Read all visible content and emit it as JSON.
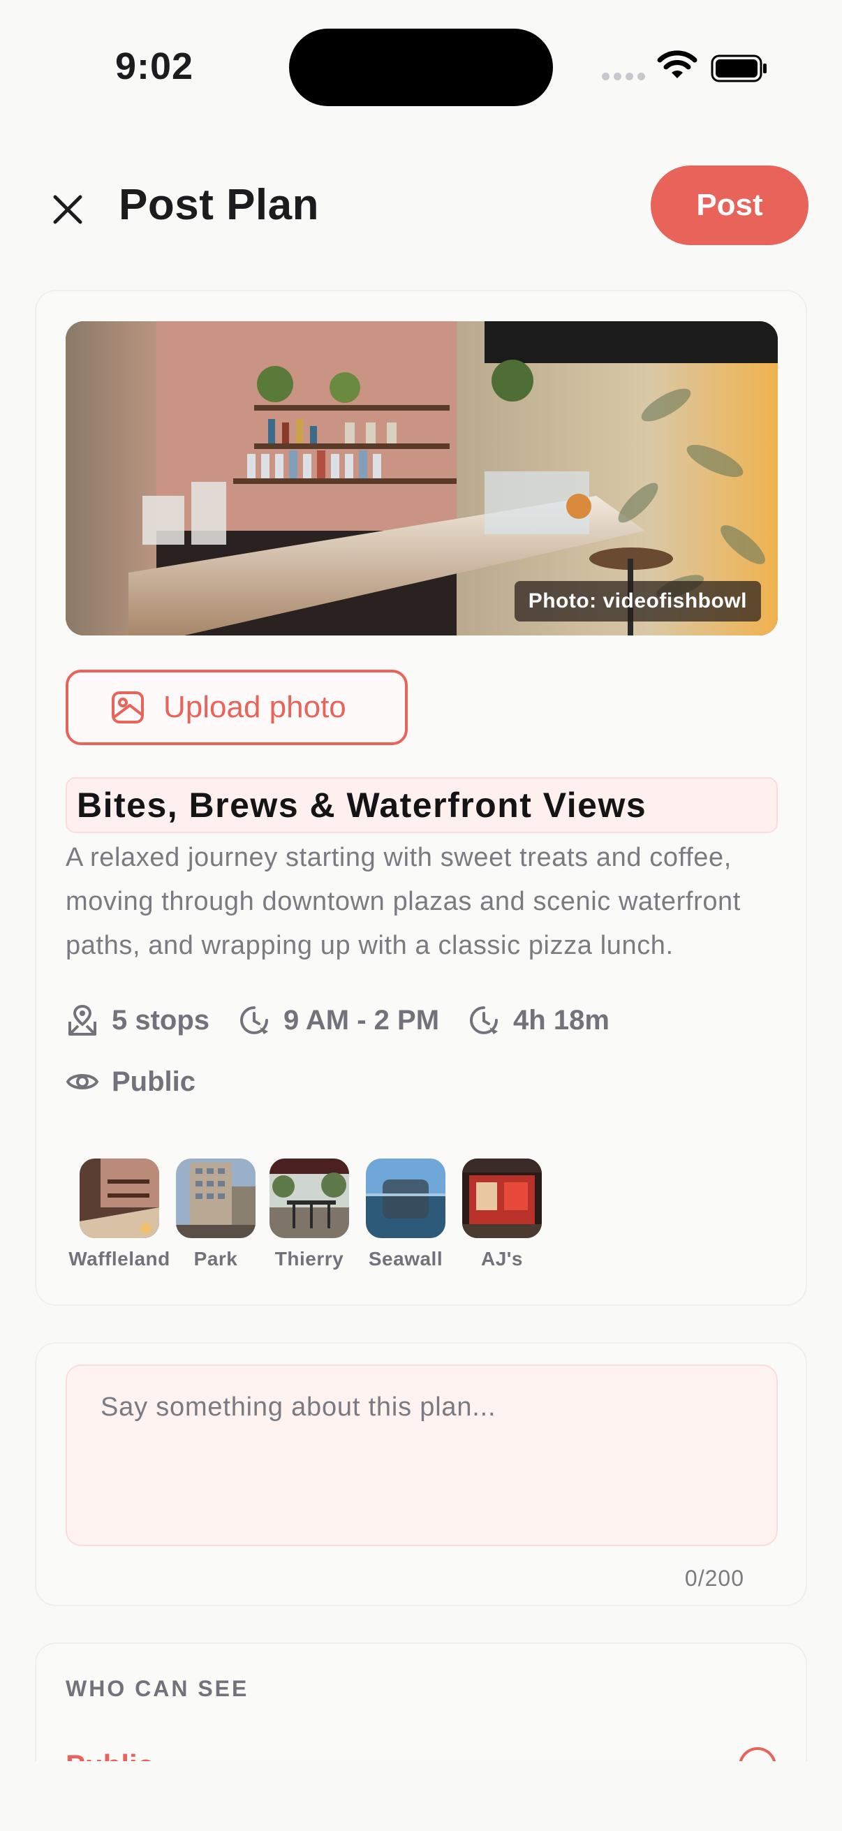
{
  "status_bar": {
    "time": "9:02"
  },
  "header": {
    "title": "Post Plan",
    "post_label": "Post",
    "close_icon": "close-icon"
  },
  "plan": {
    "photo_credit": "Photo: videofishbowl",
    "upload_label": "Upload photo",
    "title": "Bites, Brews & Waterfront Views",
    "description": "A relaxed journey starting with sweet treats and coffee, moving through downtown plazas and scenic waterfront paths, and wrapping up with a classic pizza lunch.",
    "stops_count": "5 stops",
    "time_range": "9 AM - 2 PM",
    "duration": "4h 18m",
    "visibility": "Public",
    "stops": [
      {
        "label": "Waffleland"
      },
      {
        "label": "Park"
      },
      {
        "label": "Thierry"
      },
      {
        "label": "Seawall"
      },
      {
        "label": "AJ's"
      }
    ]
  },
  "comment": {
    "placeholder": "Say something about this plan...",
    "char_count": "0/200"
  },
  "who_can_see": {
    "section_label": "WHO CAN SEE",
    "option_label": "Public"
  },
  "colors": {
    "accent": "#e8635a",
    "muted_text": "#72727a",
    "input_bg": "#fff3f2"
  }
}
